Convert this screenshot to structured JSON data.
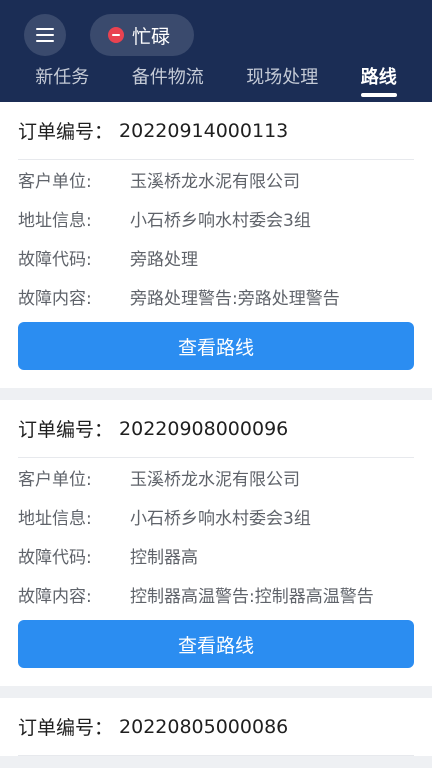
{
  "header": {
    "status": "忙碌",
    "tabs": [
      "新任务",
      "备件物流",
      "现场处理",
      "路线"
    ]
  },
  "labels": {
    "order_no": "订单编号：",
    "customer": "客户单位:",
    "address": "地址信息:",
    "fault_code": "故障代码:",
    "fault_content": "故障内容:",
    "view_route": "查看路线"
  },
  "orders": [
    {
      "order_no": "20220914000113",
      "customer": "玉溪桥龙水泥有限公司",
      "address": "小石桥乡响水村委会3组",
      "fault_code": "旁路处理",
      "fault_content": "旁路处理警告:旁路处理警告"
    },
    {
      "order_no": "20220908000096",
      "customer": "玉溪桥龙水泥有限公司",
      "address": "小石桥乡响水村委会3组",
      "fault_code": "控制器高",
      "fault_content": "控制器高温警告:控制器高温警告"
    },
    {
      "order_no": "20220805000086"
    }
  ]
}
